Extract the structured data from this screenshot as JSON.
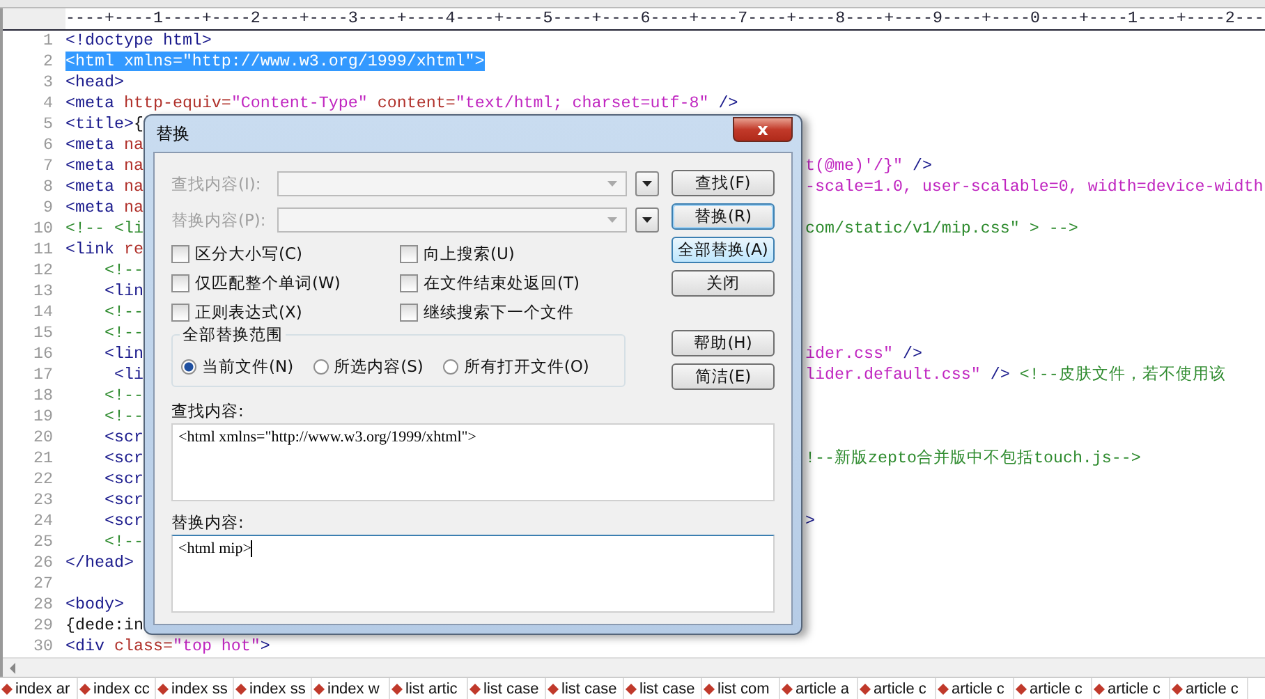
{
  "ruler": "----+----1----+----2----+----3----+----4----+----5----+----6----+----7----+----8----+----9----+----0----+----1----+----2---",
  "lines": [
    {
      "number": "1",
      "left": [
        {
          "kind": "tag",
          "t": "<!doctype html>"
        }
      ]
    },
    {
      "number": "2",
      "selected": true,
      "left": [
        {
          "kind": "tag",
          "t": "<html xmlns=\"http://www.w3.org/1999/xhtml\">"
        }
      ]
    },
    {
      "number": "3",
      "left": [
        {
          "kind": "tag",
          "t": "<head>"
        }
      ]
    },
    {
      "number": "4",
      "left": [
        {
          "kind": "tag",
          "t": "<meta"
        },
        {
          "kind": "attr",
          "t": " http-equiv="
        },
        {
          "kind": "string",
          "t": "\"Content-Type\""
        },
        {
          "kind": "attr",
          "t": " content="
        },
        {
          "kind": "string",
          "t": "\"text/html; charset=utf-8\""
        },
        {
          "kind": "tag",
          "t": " />"
        }
      ]
    },
    {
      "number": "5",
      "left": [
        {
          "kind": "tag",
          "t": "<title>"
        },
        {
          "kind": "text",
          "t": "{"
        }
      ]
    },
    {
      "number": "6",
      "left": [
        {
          "kind": "tag",
          "t": "<meta"
        },
        {
          "kind": "attr",
          "t": " na"
        }
      ]
    },
    {
      "number": "7",
      "left": [
        {
          "kind": "tag",
          "t": "<meta"
        },
        {
          "kind": "attr",
          "t": " na"
        }
      ],
      "tail": [
        {
          "kind": "string",
          "t": "t(@me)'/}\""
        },
        {
          "kind": "tag",
          "t": " />"
        }
      ]
    },
    {
      "number": "8",
      "left": [
        {
          "kind": "tag",
          "t": "<meta"
        },
        {
          "kind": "attr",
          "t": " na"
        }
      ],
      "tail": [
        {
          "kind": "string",
          "t": "-scale=1.0, user-scalable=0, width=device-width"
        }
      ]
    },
    {
      "number": "9",
      "left": [
        {
          "kind": "tag",
          "t": "<meta"
        },
        {
          "kind": "attr",
          "t": " na"
        }
      ]
    },
    {
      "number": "10",
      "left": [
        {
          "kind": "comment",
          "t": "<!-- <li"
        }
      ],
      "tail": [
        {
          "kind": "comment",
          "t": "com/static/v1/mip.css\" > -->"
        }
      ]
    },
    {
      "number": "11",
      "left": [
        {
          "kind": "tag",
          "t": "<link"
        },
        {
          "kind": "attr",
          "t": " re"
        }
      ]
    },
    {
      "number": "12",
      "left": [
        {
          "kind": "comment",
          "t": "    <!--"
        }
      ]
    },
    {
      "number": "13",
      "left": [
        {
          "kind": "tag",
          "t": "    <lin"
        }
      ]
    },
    {
      "number": "14",
      "left": [
        {
          "kind": "comment",
          "t": "    <!--"
        }
      ]
    },
    {
      "number": "15",
      "left": [
        {
          "kind": "comment",
          "t": "    <!--"
        }
      ]
    },
    {
      "number": "16",
      "left": [
        {
          "kind": "tag",
          "t": "    <lin"
        }
      ],
      "tail": [
        {
          "kind": "string",
          "t": "ider.css\""
        },
        {
          "kind": "tag",
          "t": " />"
        }
      ]
    },
    {
      "number": "17",
      "left": [
        {
          "kind": "tag",
          "t": "     <li"
        }
      ],
      "tail": [
        {
          "kind": "string",
          "t": "lider.default.css\""
        },
        {
          "kind": "tag",
          "t": " />"
        },
        {
          "kind": "comment",
          "t": " <!--皮肤文件，若不使用该"
        }
      ]
    },
    {
      "number": "18",
      "left": [
        {
          "kind": "comment",
          "t": "    <!--"
        }
      ]
    },
    {
      "number": "19",
      "left": [
        {
          "kind": "comment",
          "t": "    <!--"
        }
      ]
    },
    {
      "number": "20",
      "left": [
        {
          "kind": "tag",
          "t": "    <scr"
        }
      ]
    },
    {
      "number": "21",
      "left": [
        {
          "kind": "tag",
          "t": "    <scr"
        }
      ],
      "tail": [
        {
          "kind": "comment",
          "t": "!--新版zepto合并版中不包括touch.js-->"
        }
      ]
    },
    {
      "number": "22",
      "left": [
        {
          "kind": "tag",
          "t": "    <scr"
        }
      ]
    },
    {
      "number": "23",
      "left": [
        {
          "kind": "tag",
          "t": "    <scr"
        }
      ]
    },
    {
      "number": "24",
      "left": [
        {
          "kind": "tag",
          "t": "    <scr"
        }
      ],
      "tail": [
        {
          "kind": "tag",
          "t": ">"
        }
      ]
    },
    {
      "number": "25",
      "left": [
        {
          "kind": "comment",
          "t": "    <!--"
        }
      ]
    },
    {
      "number": "26",
      "left": [
        {
          "kind": "tag",
          "t": "</head>"
        }
      ]
    },
    {
      "number": "27"
    },
    {
      "number": "28",
      "left": [
        {
          "kind": "tag",
          "t": "<body>"
        }
      ]
    },
    {
      "number": "29",
      "left": [
        {
          "kind": "text",
          "t": "{dede:in"
        }
      ]
    },
    {
      "number": "30",
      "left": [
        {
          "kind": "tag",
          "t": "<div"
        },
        {
          "kind": "attr",
          "t": " class="
        },
        {
          "kind": "string",
          "t": "\"top hot\""
        },
        {
          "kind": "tag",
          "t": ">"
        }
      ]
    }
  ],
  "file_tabs": [
    "index ar",
    "index cc",
    "index ss",
    "index ss",
    "index w",
    "list artic",
    "list case",
    "list case",
    "list case",
    "list com",
    "article a",
    "article c",
    "article c",
    "article c",
    "article c",
    "article c"
  ],
  "dialog": {
    "title": "替换",
    "close": "x",
    "combos": [
      {
        "label": "查找内容(I):",
        "disabled": true
      },
      {
        "label": "替换内容(P):",
        "disabled": true
      }
    ],
    "buttons": [
      {
        "label": "查找(F)",
        "focused": false,
        "highlighted": false
      },
      {
        "label": "替换(R)",
        "focused": true,
        "highlighted": false
      },
      {
        "label": "全部替换(A)",
        "focused": false,
        "highlighted": true
      },
      {
        "label": "关闭",
        "focused": false,
        "highlighted": false
      }
    ],
    "options": [
      {
        "label": "区分大小写(C)",
        "checked": false
      },
      {
        "label": "向上搜索(U)",
        "checked": false
      },
      {
        "label": "仅匹配整个单词(W)",
        "checked": false
      },
      {
        "label": "在文件结束处返回(T)",
        "checked": false
      },
      {
        "label": "正则表达式(X)",
        "checked": false
      },
      {
        "label": "继续搜索下一个文件",
        "checked": false
      }
    ],
    "scope": {
      "title": "全部替换范围",
      "radios": [
        {
          "label": "当前文件(N)",
          "selected": true
        },
        {
          "label": "所选内容(S)",
          "selected": false
        },
        {
          "label": "所有打开文件(O)",
          "selected": false
        }
      ]
    },
    "extra_buttons": [
      "帮助(H)",
      "简洁(E)"
    ],
    "find": {
      "label": "查找内容:",
      "value": "<html xmlns=\"http://www.w3.org/1999/xhtml\">"
    },
    "replace": {
      "label": "替换内容:",
      "value": "<html mip>",
      "focused": true
    }
  }
}
